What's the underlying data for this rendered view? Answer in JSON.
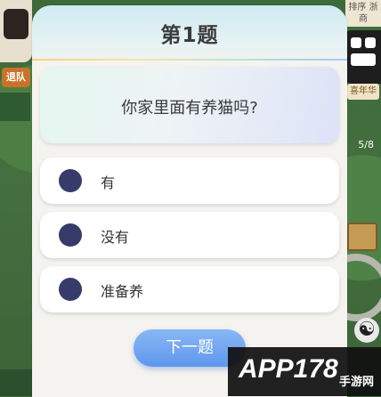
{
  "dialog": {
    "title": "第1题",
    "question": "你家里面有养猫吗?",
    "options": [
      {
        "label": "有"
      },
      {
        "label": "没有"
      },
      {
        "label": "准备养"
      }
    ],
    "next_button": "下一题"
  },
  "background": {
    "left_label": "退队",
    "right_top": "排序 浙商",
    "right_label": "喜年华",
    "right_num": "5/8"
  },
  "watermark": {
    "brand": "APP178",
    "sub": "手游网"
  },
  "colors": {
    "radio": "#363b69",
    "button_top": "#88b7f4",
    "button_bottom": "#5f97ee",
    "dialog_bg": "#f5f3ef"
  },
  "icons": {
    "radio": "radio-circle-icon",
    "yinyang": "yin-yang-icon",
    "phone": "phone-icon"
  }
}
